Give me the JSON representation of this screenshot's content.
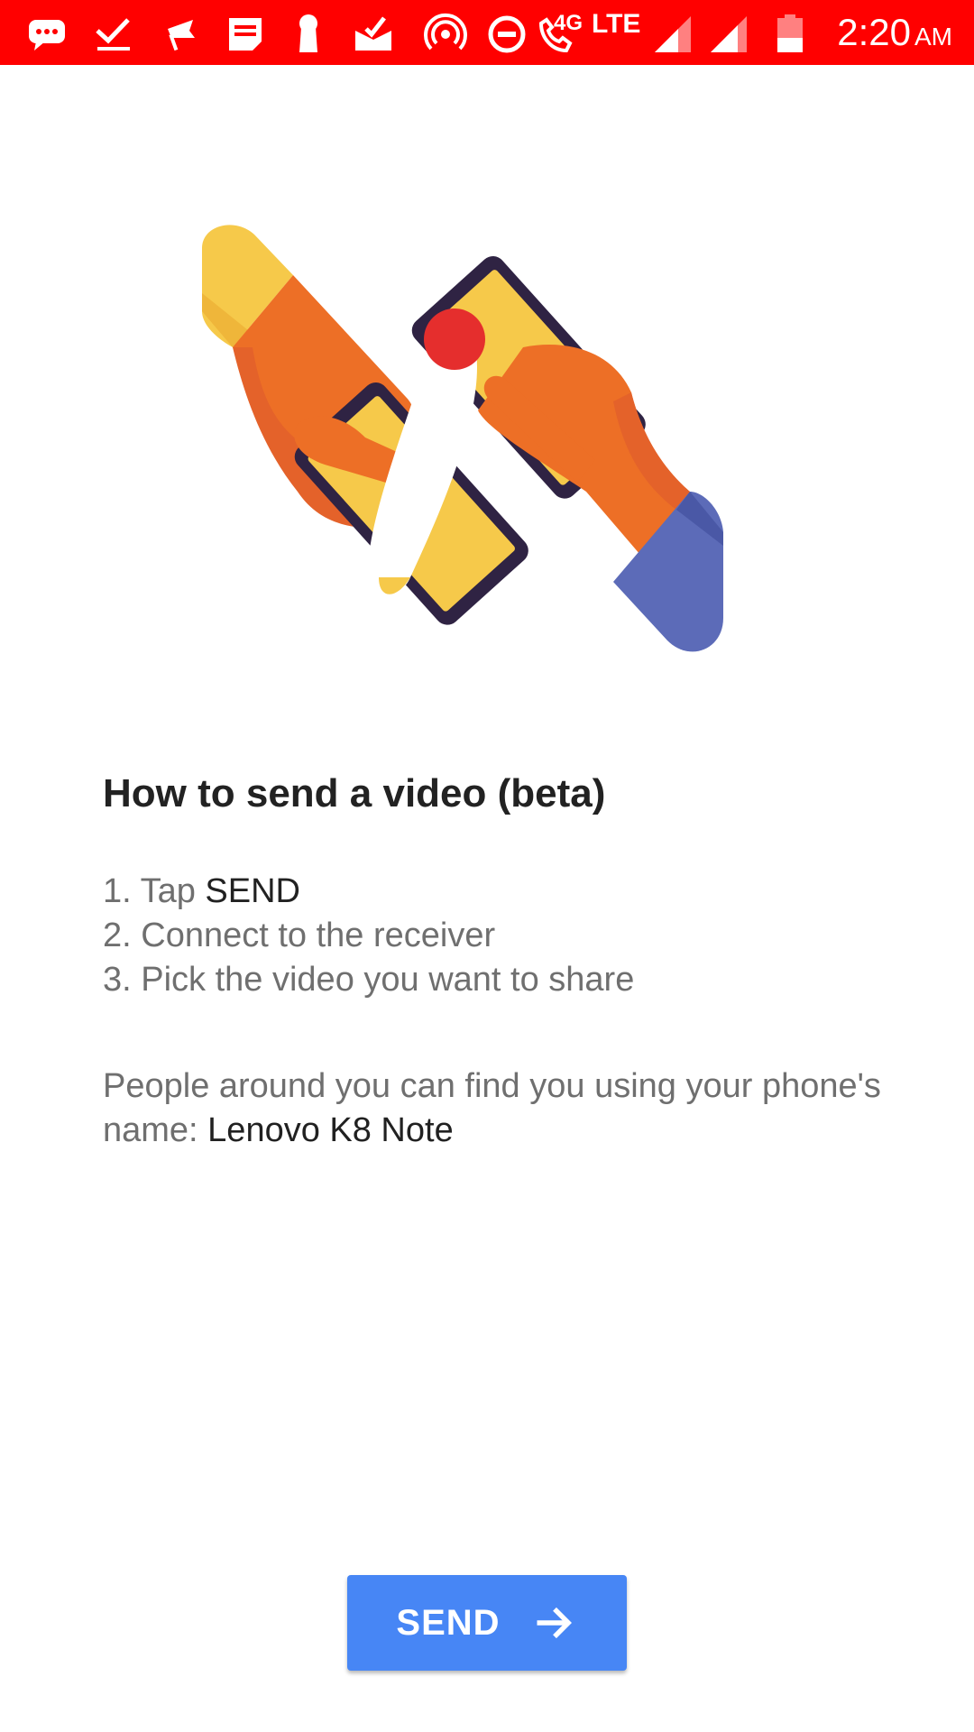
{
  "status_bar": {
    "background_color": "#ff0000",
    "icons": [
      "message-icon",
      "checkmark-icon",
      "flag-icon",
      "notes-icon",
      "keyhole-icon",
      "mail-check-icon",
      "hotspot-icon",
      "do-not-disturb-icon",
      "call-4g-icon",
      "signal-icon",
      "signal-icon",
      "battery-low-icon"
    ],
    "network_4g": "4G",
    "network_lte": "LTE",
    "time": "2:20",
    "ampm": "AM"
  },
  "illustration": {
    "icon": "two-hands-phones-share-illustration"
  },
  "content": {
    "heading": "How to send a video (beta)",
    "steps": [
      {
        "prefix": "1. Tap ",
        "emphasis": "SEND"
      },
      {
        "text": "2. Connect to the receiver"
      },
      {
        "text": "3. Pick the video you want to share"
      }
    ],
    "info_text": "People around you can find you using your phone's name: ",
    "phone_name": "Lenovo K8 Note"
  },
  "send_button": {
    "label": "SEND",
    "icon": "arrow-right-icon",
    "color": "#4786f5"
  }
}
